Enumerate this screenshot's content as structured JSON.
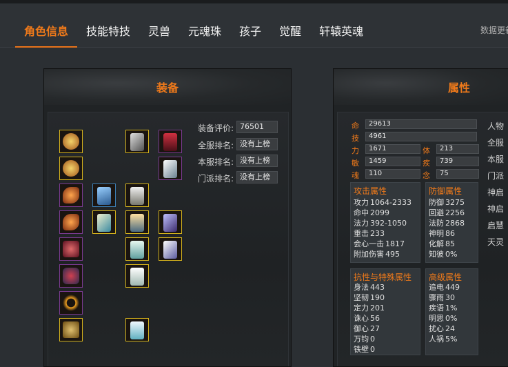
{
  "tabs": [
    {
      "label": "角色信息",
      "active": true
    },
    {
      "label": "技能特技"
    },
    {
      "label": "灵兽"
    },
    {
      "label": "元魂珠"
    },
    {
      "label": "孩子"
    },
    {
      "label": "觉醒"
    },
    {
      "label": "轩辕英魂"
    }
  ],
  "data_link": "数据更新",
  "equip_panel": {
    "title": "装备",
    "rows": [
      {
        "label": "装备评价:",
        "value": "76501"
      },
      {
        "label": "全服排名:",
        "value": "没有上榜"
      },
      {
        "label": "本服排名:",
        "value": "没有上榜"
      },
      {
        "label": "门派排名:",
        "value": "没有上榜"
      }
    ]
  },
  "attr_panel": {
    "title": "属性",
    "core": {
      "ming": {
        "label": "命",
        "value": "29613"
      },
      "ji": {
        "label": "技",
        "value": "4961"
      },
      "li": {
        "label": "力",
        "value": "1671"
      },
      "ti": {
        "label": "体",
        "value": "213"
      },
      "min": {
        "label": "敏",
        "value": "1459"
      },
      "ji2": {
        "label": "疾",
        "value": "739"
      },
      "hun": {
        "label": "魂",
        "value": "110"
      },
      "nian": {
        "label": "念",
        "value": "75"
      }
    },
    "attack": {
      "title": "攻击属性",
      "rows": [
        {
          "k": "攻力",
          "v": "1064-2333"
        },
        {
          "k": "命中",
          "v": "2099"
        },
        {
          "k": "法力",
          "v": "392-1050"
        },
        {
          "k": "重击",
          "v": "233"
        },
        {
          "k": "会心一击",
          "v": "1817"
        },
        {
          "k": "附加伤害",
          "v": "495"
        }
      ]
    },
    "defense": {
      "title": "防御属性",
      "rows": [
        {
          "k": "防御",
          "v": "3275"
        },
        {
          "k": "回避",
          "v": "2256"
        },
        {
          "k": "法防",
          "v": "2868"
        },
        {
          "k": "神明",
          "v": "86"
        },
        {
          "k": "化解",
          "v": "85"
        },
        {
          "k": "知彼",
          "v": "0%"
        }
      ]
    },
    "resist": {
      "title": "抗性与特殊属性",
      "rows": [
        {
          "k": "身法",
          "v": "443"
        },
        {
          "k": "坚韧",
          "v": "190"
        },
        {
          "k": "定力",
          "v": "201"
        },
        {
          "k": "诛心",
          "v": "56"
        },
        {
          "k": "御心",
          "v": "27"
        },
        {
          "k": "万钧",
          "v": "0"
        },
        {
          "k": "铁壁",
          "v": "0"
        }
      ]
    },
    "advanced": {
      "title": "高级属性",
      "rows": [
        {
          "k": "追电",
          "v": "449"
        },
        {
          "k": "骤雨",
          "v": "30"
        },
        {
          "k": "疾语",
          "v": "1%"
        },
        {
          "k": "明思",
          "v": "0%"
        },
        {
          "k": "扰心",
          "v": "24"
        },
        {
          "k": "人祸",
          "v": "5%"
        }
      ]
    },
    "side_labels": [
      "人物",
      "全服",
      "本服",
      "门派",
      "神启",
      "神启",
      "启慧",
      "天灵"
    ]
  },
  "colors": {
    "accent": "#f07a1a",
    "panel": "#202325",
    "epic_border": "#7a3a90",
    "legend_border": "#d4b21c"
  }
}
